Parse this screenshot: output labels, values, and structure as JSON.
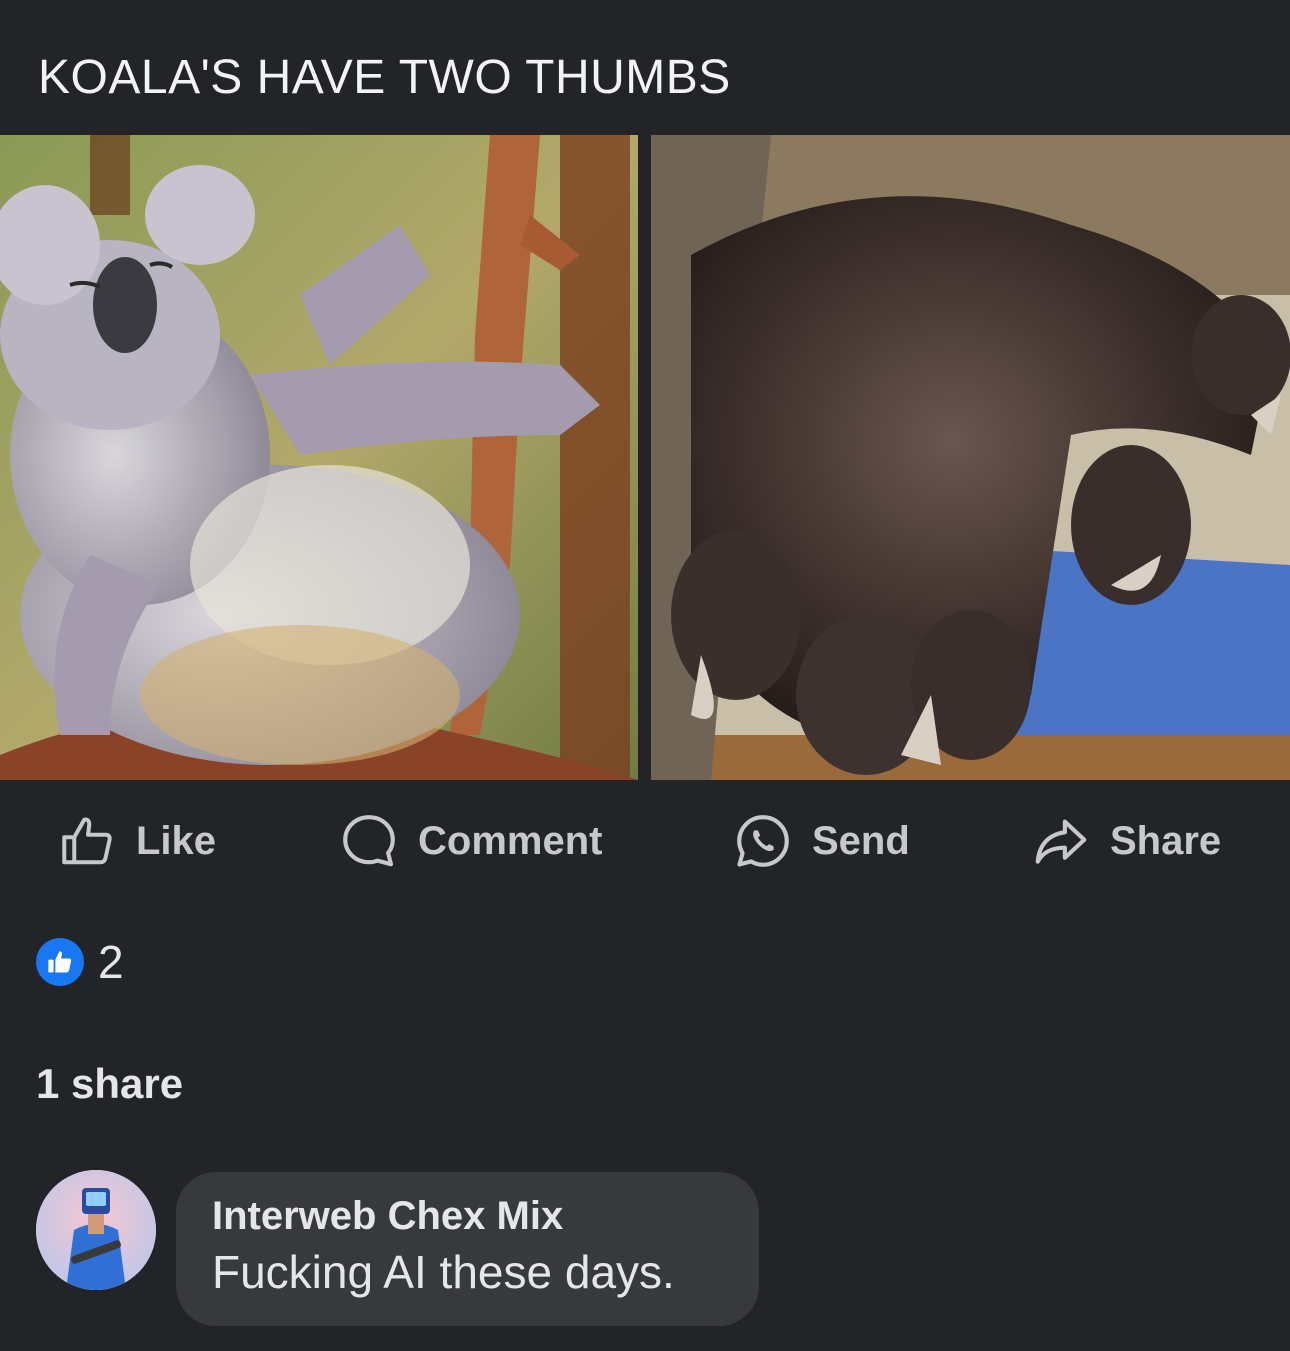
{
  "post": {
    "title": "KOALA'S HAVE TWO THUMBS"
  },
  "images": [
    {
      "icon": "koala-photo",
      "alt": "koala"
    },
    {
      "icon": "koala-hand-photo",
      "alt": "koala hand"
    }
  ],
  "actions": {
    "like_label": "Like",
    "comment_label": "Comment",
    "send_label": "Send",
    "share_label": "Share"
  },
  "reactions": {
    "icon": "thumbs-up-icon",
    "count": "2",
    "color": "#1877f2"
  },
  "shares": {
    "label": "1 share"
  },
  "comments": [
    {
      "author": "Interweb Chex Mix",
      "text": "Fucking AI these days.",
      "avatar_icon": "user-avatar"
    }
  ],
  "colors": {
    "background": "#232427",
    "bubble": "#38393d",
    "action_text": "#c6c8cc",
    "accent": "#1877f2"
  }
}
